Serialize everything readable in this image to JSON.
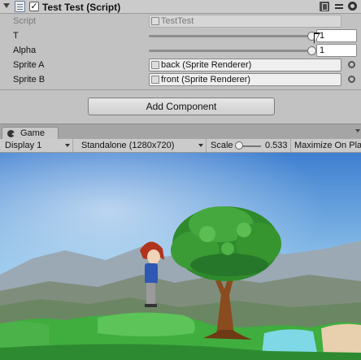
{
  "component": {
    "title": "Test Test (Script)",
    "enabled": "✓"
  },
  "properties": {
    "script": {
      "label": "Script",
      "value": "TestTest"
    },
    "t": {
      "label": "T",
      "value": "1",
      "slider_fraction": 1.0
    },
    "alpha": {
      "label": "Alpha",
      "value": "1",
      "slider_fraction": 1.0
    },
    "sprite_a": {
      "label": "Sprite A",
      "value": "back (Sprite Renderer)"
    },
    "sprite_b": {
      "label": "Sprite B",
      "value": "front (Sprite Renderer)"
    }
  },
  "add_component_label": "Add Component",
  "game": {
    "tab_label": "Game",
    "display": "Display 1",
    "aspect": "Standalone (1280x720)",
    "scale_label": "Scale",
    "scale_value": "0.533",
    "maximize": "Maximize On Play"
  },
  "colors": {
    "sky_top": "#3e7fd0",
    "sky_bottom": "#d8ecf6",
    "grass": "#3fae3f",
    "foliage": "#2f8a2c",
    "trunk": "#8a4b1f",
    "water": "#7fd8e6"
  }
}
